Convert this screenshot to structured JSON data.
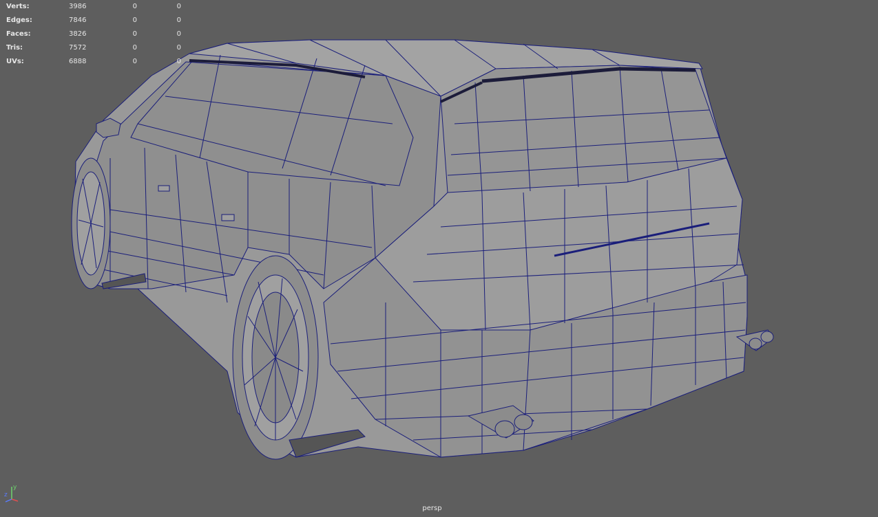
{
  "hud": {
    "rows": [
      {
        "label": "Verts:",
        "v1": "3986",
        "v2": "0",
        "v3": "0"
      },
      {
        "label": "Edges:",
        "v1": "7846",
        "v2": "0",
        "v3": "0"
      },
      {
        "label": "Faces:",
        "v1": "3826",
        "v2": "0",
        "v3": "0"
      },
      {
        "label": "Tris:",
        "v1": "7572",
        "v2": "0",
        "v3": "0"
      },
      {
        "label": "UVs:",
        "v1": "6888",
        "v2": "0",
        "v3": "0"
      }
    ]
  },
  "camera": {
    "label": "persp"
  },
  "axis": {
    "y": "y",
    "z": "z"
  },
  "colors": {
    "background": "#5e5e5e",
    "wire": "#1a1e7a",
    "surface": "#9a9a9a",
    "surface_dark": "#7d7d7d",
    "axis_y": "#6ed36e",
    "axis_z": "#5a7cff",
    "axis_x": "#e05050"
  }
}
